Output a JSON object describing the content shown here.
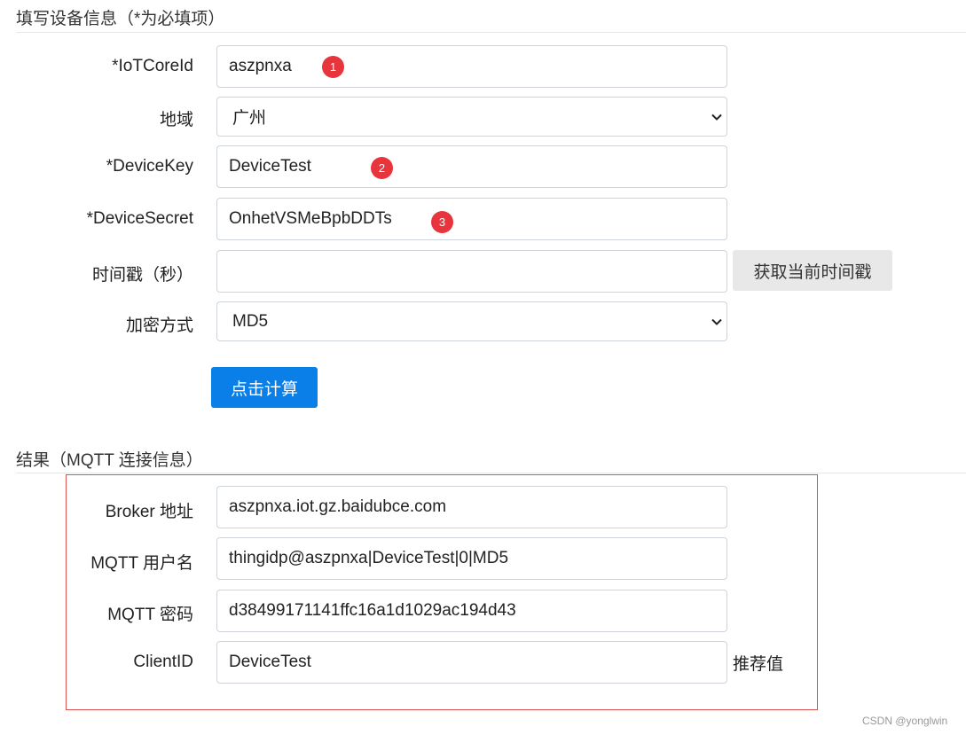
{
  "form": {
    "title": "填写设备信息（*为必填项）",
    "iotcoreid": {
      "label": "*IoTCoreId",
      "value": "aszpnxa"
    },
    "region": {
      "label": "地域",
      "value": "广州"
    },
    "devicekey": {
      "label": "*DeviceKey",
      "value": "DeviceTest"
    },
    "devicesecret": {
      "label": "*DeviceSecret",
      "value": "OnhetVSMeBpbDDTs"
    },
    "timestamp": {
      "label": "时间戳（秒）",
      "value": "",
      "button": "获取当前时间戳"
    },
    "encryption": {
      "label": "加密方式",
      "value": "MD5"
    },
    "calculate_button": "点击计算"
  },
  "badges": [
    "1",
    "2",
    "3"
  ],
  "result": {
    "title": "结果（MQTT 连接信息）",
    "broker": {
      "label": "Broker 地址",
      "value": "aszpnxa.iot.gz.baidubce.com"
    },
    "username": {
      "label": "MQTT 用户名",
      "value": "thingidp@aszpnxa|DeviceTest|0|MD5"
    },
    "password": {
      "label": "MQTT 密码",
      "value": "d38499171141ffc16a1d1029ac194d43"
    },
    "clientid": {
      "label": "ClientID",
      "value": "DeviceTest",
      "hint": "推荐值"
    }
  },
  "watermark": "CSDN @yonglwin",
  "colors": {
    "badge": "#e8343c",
    "primary_button": "#0a7fe8",
    "result_border": "#d9534f"
  }
}
